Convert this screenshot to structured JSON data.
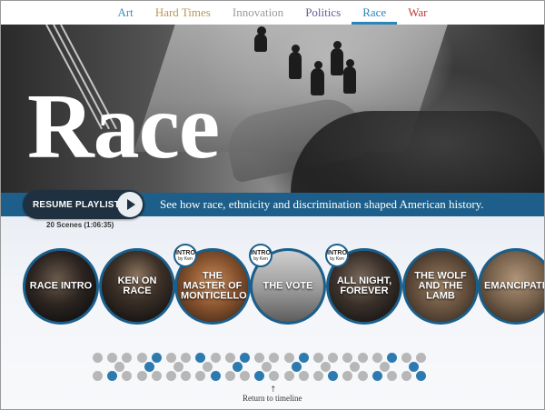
{
  "nav": {
    "tabs": [
      {
        "label": "Art",
        "color": "#3a8fbf"
      },
      {
        "label": "Hard Times",
        "color": "#b8955a"
      },
      {
        "label": "Innovation",
        "color": "#9a9a9a"
      },
      {
        "label": "Politics",
        "color": "#6a5a9a"
      },
      {
        "label": "Race",
        "color": "#2a86b6"
      },
      {
        "label": "War",
        "color": "#c0353a"
      }
    ],
    "active": "Race"
  },
  "hero": {
    "title": "Race"
  },
  "band": {
    "tagline": "See how race, ethnicity and discrimination shaped American history."
  },
  "resume_button": {
    "label": "RESUME PLAYLIST",
    "icon": "play-icon"
  },
  "scene_count": "20 Scenes (1:06:35)",
  "scenes": [
    {
      "title": "RACE INTRO",
      "intro": false
    },
    {
      "title": "KEN ON RACE",
      "intro": false
    },
    {
      "title": "THE MASTER OF MONTICELLO",
      "intro": true
    },
    {
      "title": "THE VOTE",
      "intro": true
    },
    {
      "title": "ALL NIGHT, FOREVER",
      "intro": true
    },
    {
      "title": "THE WOLF AND THE LAMB",
      "intro": false
    },
    {
      "title": "EMANCIPATION",
      "intro": false
    }
  ],
  "intro_badge": {
    "line1": "INTRO",
    "line2": "by Ken"
  },
  "timeline": {
    "marker": "↑",
    "return_label": "Return to timeline"
  },
  "colors": {
    "accent": "#1a5f8b",
    "band": "#1d5f8a",
    "dot_active": "#2d7ab0"
  }
}
